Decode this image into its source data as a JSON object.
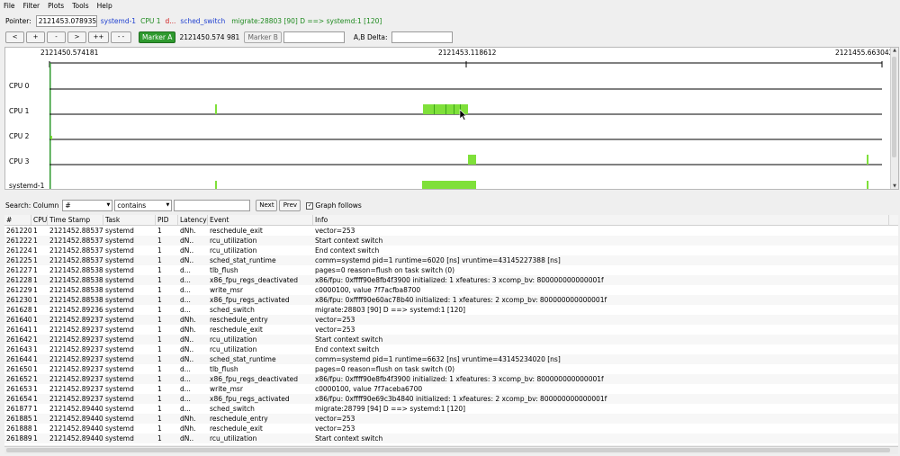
{
  "menubar": [
    "File",
    "Filter",
    "Plots",
    "Tools",
    "Help"
  ],
  "pointer": {
    "label": "Pointer:",
    "value": "2121453.078935",
    "task": "systemd-1",
    "cpu": "CPU 1",
    "latency": "d...",
    "event": "sched_switch",
    "info": "migrate:28803 [90] D ==> systemd:1 [120]"
  },
  "nav_buttons": [
    "<",
    "+",
    "-",
    ">",
    "++",
    "- -"
  ],
  "marker_a": {
    "label": "Marker A",
    "value": "2121450.574 981"
  },
  "marker_b": {
    "label": "Marker B",
    "value": ""
  },
  "ab_delta": {
    "label": "A,B Delta:",
    "value": ""
  },
  "graph": {
    "time_labels": [
      "2121450.574181",
      "2121453.118612",
      "2121455.663042"
    ],
    "rows": [
      "CPU 0",
      "CPU 1",
      "CPU 2",
      "CPU 3",
      "systemd-1"
    ]
  },
  "search": {
    "label": "Search: Column",
    "column": "#",
    "op": "contains",
    "text": "",
    "next": "Next",
    "prev": "Prev",
    "graph_follows": "Graph follows"
  },
  "table": {
    "headers": [
      "#",
      "CPU",
      "Time Stamp",
      "Task",
      "PID",
      "Latency",
      "Event",
      "Info"
    ],
    "rows": [
      [
        "261220",
        "1",
        "2121452.885378",
        "systemd",
        "1",
        "dNh.",
        "reschedule_exit",
        "vector=253"
      ],
      [
        "261222",
        "1",
        "2121452.885378",
        "systemd",
        "1",
        "dN..",
        "rcu_utilization",
        "Start context switch"
      ],
      [
        "261224",
        "1",
        "2121452.885379",
        "systemd",
        "1",
        "dN..",
        "rcu_utilization",
        "End context switch"
      ],
      [
        "261225",
        "1",
        "2121452.885379",
        "systemd",
        "1",
        "dN..",
        "sched_stat_runtime",
        "comm=systemd pid=1 runtime=6020 [ns] vruntime=43145227388 [ns]"
      ],
      [
        "261227",
        "1",
        "2121452.885380",
        "systemd",
        "1",
        "d...",
        "tlb_flush",
        "pages=0 reason=flush on task switch (0)"
      ],
      [
        "261228",
        "1",
        "2121452.885381",
        "systemd",
        "1",
        "d...",
        "x86_fpu_regs_deactivated",
        "x86/fpu: 0xffff90e8fb4f3900 initialized: 1 xfeatures: 3 xcomp_bv: 800000000000001f"
      ],
      [
        "261229",
        "1",
        "2121452.885381",
        "systemd",
        "1",
        "d...",
        "write_msr",
        "c0000100, value 7f7acfba8700"
      ],
      [
        "261230",
        "1",
        "2121452.885381",
        "systemd",
        "1",
        "d...",
        "x86_fpu_regs_activated",
        "x86/fpu: 0xffff90e60ac78b40 initialized: 1 xfeatures: 2 xcomp_bv: 800000000000001f"
      ],
      [
        "261628",
        "1",
        "2121452.892365",
        "systemd",
        "1",
        "d...",
        "sched_switch",
        "migrate:28803 [90] D ==> systemd:1 [120]"
      ],
      [
        "261640",
        "1",
        "2121452.892370",
        "systemd",
        "1",
        "dNh.",
        "reschedule_entry",
        "vector=253"
      ],
      [
        "261641",
        "1",
        "2121452.892370",
        "systemd",
        "1",
        "dNh.",
        "reschedule_exit",
        "vector=253"
      ],
      [
        "261642",
        "1",
        "2121452.892370",
        "systemd",
        "1",
        "dN..",
        "rcu_utilization",
        "Start context switch"
      ],
      [
        "261643",
        "1",
        "2121452.892371",
        "systemd",
        "1",
        "dN..",
        "rcu_utilization",
        "End context switch"
      ],
      [
        "261644",
        "1",
        "2121452.892371",
        "systemd",
        "1",
        "dN..",
        "sched_stat_runtime",
        "comm=systemd pid=1 runtime=6632 [ns] vruntime=43145234020 [ns]"
      ],
      [
        "261650",
        "1",
        "2121452.892372",
        "systemd",
        "1",
        "d...",
        "tlb_flush",
        "pages=0 reason=flush on task switch (0)"
      ],
      [
        "261652",
        "1",
        "2121452.892373",
        "systemd",
        "1",
        "d...",
        "x86_fpu_regs_deactivated",
        "x86/fpu: 0xffff90e8fb4f3900 initialized: 1 xfeatures: 3 xcomp_bv: 800000000000001f"
      ],
      [
        "261653",
        "1",
        "2121452.892373",
        "systemd",
        "1",
        "d...",
        "write_msr",
        "c0000100, value 7f7aceba6700"
      ],
      [
        "261654",
        "1",
        "2121452.892374",
        "systemd",
        "1",
        "d...",
        "x86_fpu_regs_activated",
        "x86/fpu: 0xffff90e69c3b4840 initialized: 1 xfeatures: 2 xcomp_bv: 800000000000001f"
      ],
      [
        "261877",
        "1",
        "2121452.894400",
        "systemd",
        "1",
        "d...",
        "sched_switch",
        "migrate:28799 [94] D ==> systemd:1 [120]"
      ],
      [
        "261885",
        "1",
        "2121452.894404",
        "systemd",
        "1",
        "dNh.",
        "reschedule_entry",
        "vector=253"
      ],
      [
        "261888",
        "1",
        "2121452.894404",
        "systemd",
        "1",
        "dNh.",
        "reschedule_exit",
        "vector=253"
      ],
      [
        "261889",
        "1",
        "2121452.894404",
        "systemd",
        "1",
        "dN..",
        "rcu_utilization",
        "Start context switch"
      ]
    ]
  },
  "colors": {
    "accent_green": "#2f9a2f",
    "trace_green": "#7fe03a",
    "task_blue": "#1e3fd0",
    "latency_red": "#d01e1e",
    "event_green": "#1f8a1f"
  }
}
